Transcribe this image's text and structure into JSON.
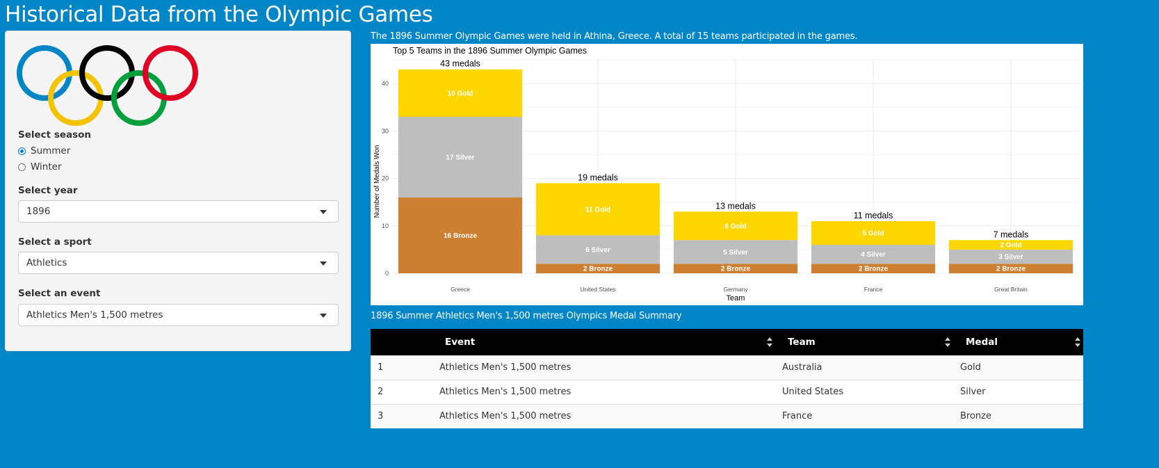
{
  "header": {
    "title": "Historical Data from the Olympic Games"
  },
  "sidebar": {
    "logo_name": "olympic-rings",
    "season": {
      "label": "Select season",
      "options": [
        {
          "label": "Summer",
          "checked": true
        },
        {
          "label": "Winter",
          "checked": false
        }
      ]
    },
    "year": {
      "label": "Select year",
      "value": "1896"
    },
    "sport": {
      "label": "Select a sport",
      "value": "Athletics"
    },
    "event": {
      "label": "Select an event",
      "value": "Athletics Men's 1,500 metres"
    }
  },
  "main": {
    "intro": "The 1896 Summer Olympic Games were held in Athina, Greece. A total of 15 teams participated in the games.",
    "table_caption": "1896 Summer Athletics Men's 1,500 metres Olympics Medal Summary",
    "table": {
      "columns": [
        "",
        "Event",
        "Team",
        "Medal"
      ],
      "rows": [
        [
          "1",
          "Athletics Men's 1,500 metres",
          "Australia",
          "Gold"
        ],
        [
          "2",
          "Athletics Men's 1,500 metres",
          "United States",
          "Silver"
        ],
        [
          "3",
          "Athletics Men's 1,500 metres",
          "France",
          "Bronze"
        ]
      ]
    }
  },
  "colors": {
    "gold": "#ffd700",
    "silver": "#bebebe",
    "bronze": "#cd7f32",
    "background": "#0085c7"
  },
  "chart_data": {
    "type": "bar",
    "stacked": true,
    "title": "Top 5 Teams in the 1896 Summer Olympic Games",
    "xlabel": "Team",
    "ylabel": "Number of Medals Won",
    "ylim": [
      0,
      45
    ],
    "yticks": [
      0,
      10,
      20,
      30,
      40
    ],
    "grid": true,
    "categories": [
      "Greece",
      "United States",
      "Germany",
      "France",
      "Great Britain"
    ],
    "series": [
      {
        "name": "Bronze",
        "values": [
          16,
          2,
          2,
          2,
          2
        ],
        "labels": [
          "16 Bronze",
          "2 Bronze",
          "2 Bronze",
          "2 Bronze",
          "2 Bronze"
        ]
      },
      {
        "name": "Silver",
        "values": [
          17,
          6,
          5,
          4,
          3
        ],
        "labels": [
          "17 Silver",
          "6 Silver",
          "5 Silver",
          "4 Silver",
          "3 Silver"
        ]
      },
      {
        "name": "Gold",
        "values": [
          10,
          11,
          6,
          5,
          2
        ],
        "labels": [
          "10 Gold",
          "11 Gold",
          "6 Gold",
          "5 Gold",
          "2 Gold"
        ]
      }
    ],
    "totals": [
      43,
      19,
      13,
      11,
      7
    ],
    "total_labels": [
      "43 medals",
      "19 medals",
      "13 medals",
      "11 medals",
      "7 medals"
    ]
  }
}
